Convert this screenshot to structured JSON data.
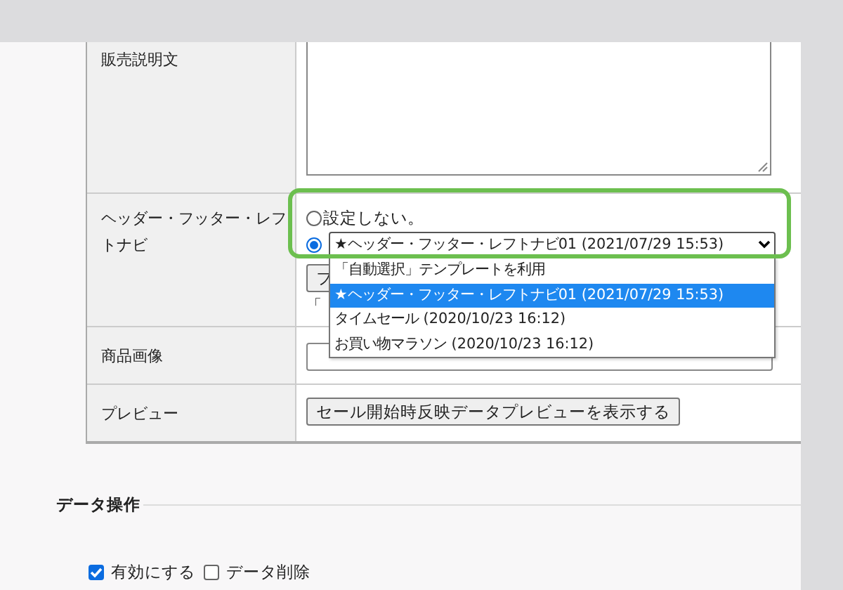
{
  "form_rows": [
    {
      "kind": "textarea",
      "label": "販売説明文"
    },
    {
      "kind": "template",
      "label": "ヘッダー・フッター・レフトナビ",
      "radios": [
        {
          "label": "設定しない。",
          "selected": false
        },
        {
          "selected": true
        }
      ],
      "select": {
        "value": "★ヘッダー・フッター・レフトナビ01 (2021/07/29 15:53)",
        "expanded": true,
        "options": [
          {
            "label": "「自動選択」テンプレートを利用",
            "selected": false
          },
          {
            "label": "★ヘッダー・フッター・レフトナビ01 (2021/07/29 15:53)",
            "selected": true
          },
          {
            "label": "タイムセール (2020/10/23 16:12)",
            "selected": false
          },
          {
            "label": "お買い物マラソン (2020/10/23 16:12)",
            "selected": false
          }
        ]
      },
      "button": "フ",
      "note": "「"
    },
    {
      "kind": "field",
      "label": "商品画像"
    },
    {
      "kind": "button",
      "label": "プレビュー",
      "button": "セール開始時反映データプレビューを表示する"
    }
  ],
  "section": {
    "title": "データ操作"
  },
  "checkboxes": [
    {
      "label": "有効にする",
      "checked": true
    },
    {
      "label": "データ削除",
      "checked": false
    }
  ]
}
